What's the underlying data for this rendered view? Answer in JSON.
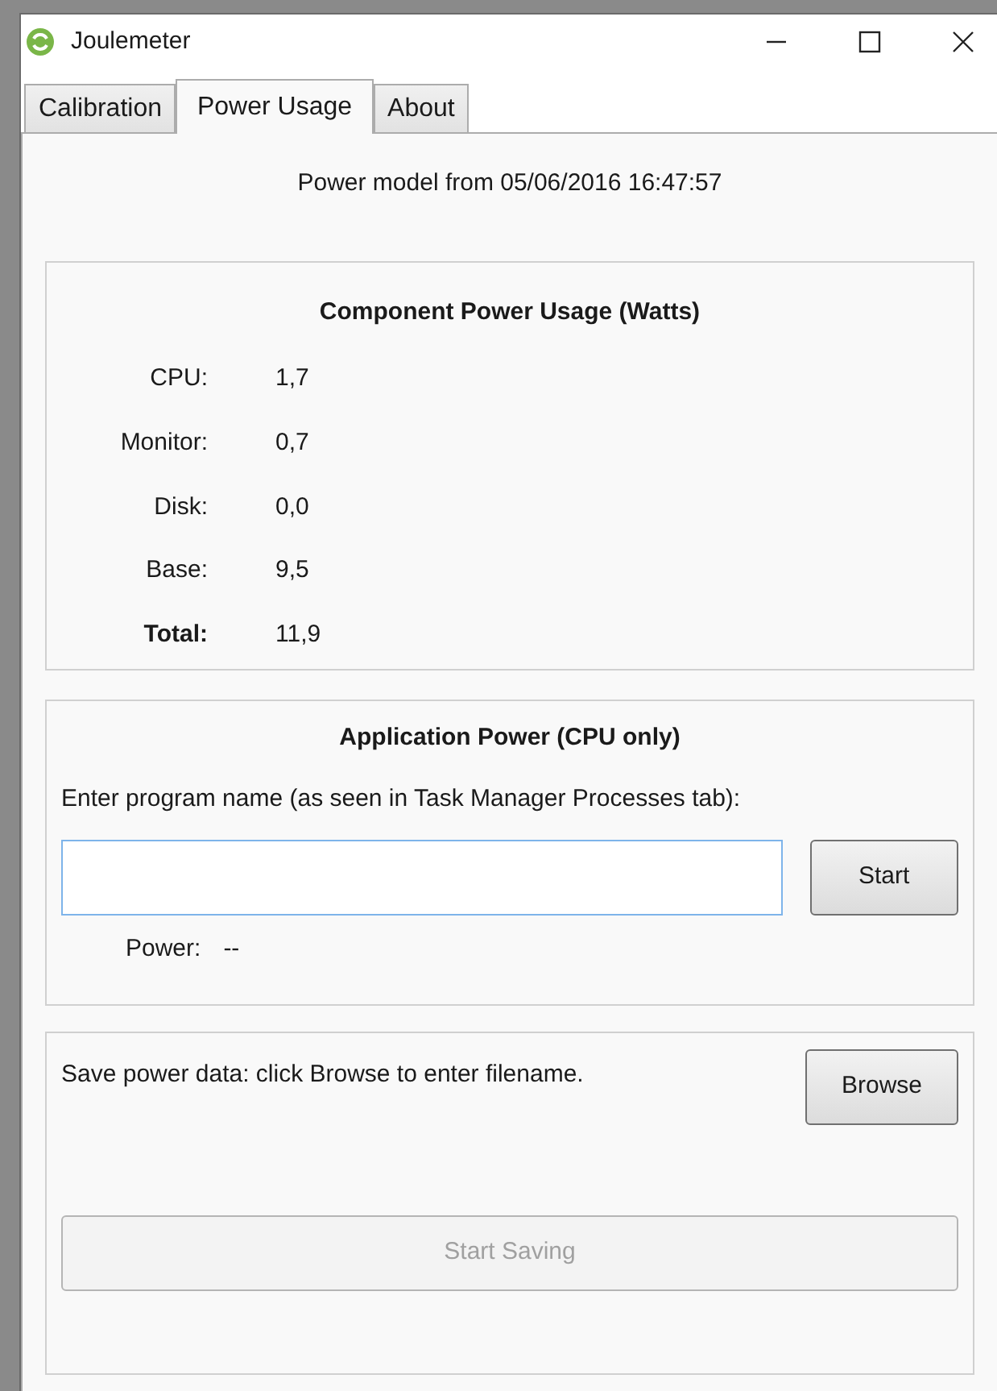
{
  "window": {
    "title": "Joulemeter"
  },
  "tabs": [
    {
      "label": "Calibration",
      "selected": false
    },
    {
      "label": "Power Usage",
      "selected": true
    },
    {
      "label": "About",
      "selected": false
    }
  ],
  "model_info": "Power model from 05/06/2016 16:47:57",
  "component_power": {
    "title": "Component Power Usage (Watts)",
    "rows": [
      {
        "label": "CPU:",
        "value": "1,7",
        "bold": false
      },
      {
        "label": "Monitor:",
        "value": "0,7",
        "bold": false
      },
      {
        "label": "Disk:",
        "value": "0,0",
        "bold": false
      },
      {
        "label": "Base:",
        "value": "9,5",
        "bold": false
      },
      {
        "label": "Total:",
        "value": "11,9",
        "bold": true
      }
    ]
  },
  "application_power": {
    "title": "Application Power (CPU only)",
    "prompt": "Enter program name (as seen in Task Manager Processes tab):",
    "start_button": "Start",
    "power_label": "Power:",
    "power_value": "--"
  },
  "save": {
    "text": "Save power data: click Browse to enter filename.",
    "browse_button": "Browse",
    "start_saving_button": {
      "label": "Start Saving",
      "disabled": true
    }
  }
}
